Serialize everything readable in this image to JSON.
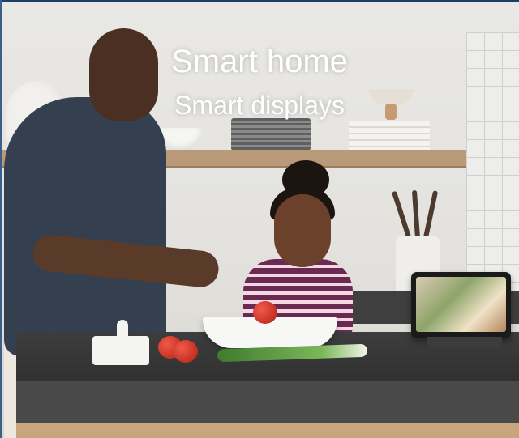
{
  "banner": {
    "title": "Smart home",
    "subtitle": "Smart displays"
  },
  "colors": {
    "text": "#ffffff",
    "top_border": "#1d3f66",
    "counter": "#2f2f2f"
  },
  "image": {
    "icon": "kitchen-scene-photo"
  }
}
